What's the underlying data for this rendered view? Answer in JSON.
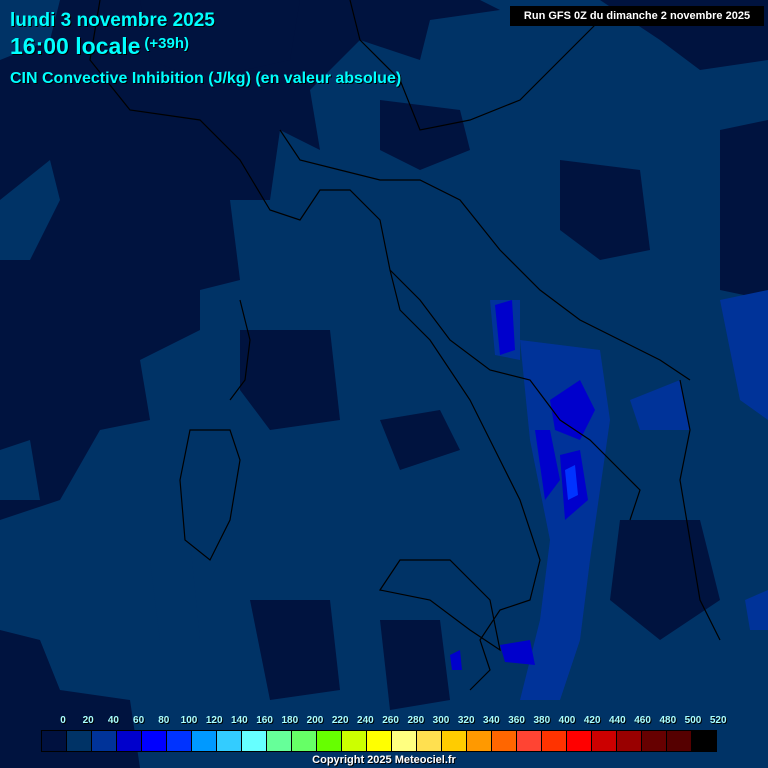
{
  "header": {
    "date": "lundi 3 novembre 2025",
    "time": "16:00 locale",
    "offset": "(+39h)",
    "parameter": "CIN Convective Inhibition (J/kg) (en valeur absolue)",
    "run": "Run GFS 0Z du dimanche 2 novembre 2025"
  },
  "legend": {
    "labels": [
      "0",
      "20",
      "40",
      "60",
      "80",
      "100",
      "120",
      "140",
      "160",
      "180",
      "200",
      "220",
      "240",
      "260",
      "280",
      "300",
      "320",
      "340",
      "360",
      "380",
      "400",
      "420",
      "440",
      "460",
      "480",
      "500",
      "520"
    ],
    "colors": [
      "#00113f",
      "#003366",
      "#003399",
      "#0000cc",
      "#0000ff",
      "#0033ff",
      "#0099ff",
      "#33ccff",
      "#66ffff",
      "#66ff99",
      "#66ff66",
      "#66ff00",
      "#ccff00",
      "#ffff00",
      "#ffff80",
      "#ffe050",
      "#ffcc00",
      "#ff9900",
      "#ff6600",
      "#ff4433",
      "#ff3300",
      "#ff0000",
      "#cc0000",
      "#990000",
      "#660000",
      "#550000",
      "#000000"
    ]
  },
  "copyright": "Copyright 2025 Meteociel.fr"
}
